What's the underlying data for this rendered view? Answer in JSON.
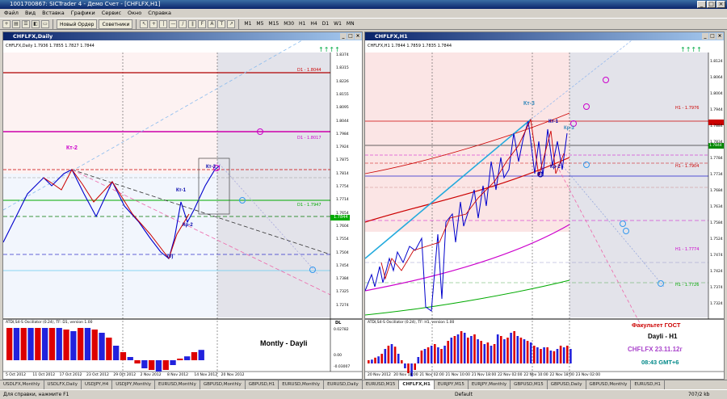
{
  "window": {
    "title": "1001700867: SICTrader 4 - Демо Счет - [CHFLFX,H1]"
  },
  "menu": [
    "Файл",
    "Вид",
    "Вставка",
    "Графики",
    "Сервис",
    "Окно",
    "Справка"
  ],
  "toolbar": {
    "new_order": "Новый Ордер",
    "advisors": "Советники",
    "timeframes": [
      "M1",
      "M5",
      "M15",
      "M30",
      "H1",
      "H4",
      "D1",
      "W1",
      "MN"
    ]
  },
  "left_chart": {
    "title": "CHFLFX,Daily",
    "header": "CHFLFX,Daily 1.7936 1.7855 1.7827 1.7844",
    "labels": {
      "kt2": "Кт-2",
      "kt1": "Кт-1",
      "kr2": "Кр-2",
      "kt3": "Кт-3",
      "zero": "(0)",
      "d1a": "D1 - 1.8044",
      "d1b": "D1 - 1.8017",
      "d1c": "D1 - 1.7947",
      "dl": "DL"
    },
    "price_labels": [
      "1.8374",
      "1.8315",
      "1.8226",
      "1.8155",
      "1.8095",
      "1.8044",
      "1.7984",
      "1.7924",
      "1.7875",
      "1.7814",
      "1.7754",
      "1.7714",
      "1.7654",
      "1.7604",
      "1.7554",
      "1.7504",
      "1.7454",
      "1.7384",
      "1.7325",
      "1.7274"
    ],
    "current_price": "1.7844",
    "indicator_header": "ATDI,S4-S Oscillator (0.24), TF: D1, version 1.00",
    "indicator_scale": [
      "0.02782",
      "0.00",
      "-0.03007"
    ],
    "dates": [
      "5 Oct 2012",
      "11 Oct 2012",
      "17 Oct 2012",
      "23 Oct 2012",
      "29 Oct 2012",
      "2 Nov 2012",
      "8 Nov 2012",
      "14 Nov 2012",
      "20 Nov 2012"
    ],
    "caption": "Montly - Dayli"
  },
  "right_chart": {
    "title": "CHFLFX,H1",
    "header": "CHFLFX,H1 1.7844 1.7859 1.7835 1.7844",
    "labels": {
      "kt3": "Кт-3",
      "kt1": "Кт-1",
      "kr3": "Кр-3",
      "kr2": "Кр-2",
      "zero": "(0)",
      "h1a": "H1 - 1.7976",
      "h1b": "H1 - 1.7904",
      "h1c": "H1 - 1.7774",
      "h1d": "H1 - 1.7726"
    },
    "price_labels": [
      "1.8124",
      "1.8064",
      "1.8004",
      "1.7944",
      "1.7884",
      "1.7834",
      "1.7784",
      "1.7734",
      "1.7684",
      "1.7634",
      "1.7584",
      "1.7524",
      "1.7474",
      "1.7424",
      "1.7374",
      "1.7324"
    ],
    "current_price": "1.7844",
    "indicator_header": "ATDI,S4-S Oscillator (0.24), TF: H1, version 1.00",
    "dates": [
      "20 Nov 2012",
      "20 Nov 18:00",
      "21 Nov 02:00",
      "21 Nov 10:00",
      "21 Nov 18:00",
      "22 Nov 02:00",
      "22 Nov 10:00",
      "22 Nov 18:00",
      "23 Nov 02:00"
    ],
    "info": {
      "line1": "Факультет ГОСТ",
      "line2": "Dayli - H1",
      "line3": "CHFLFX 23.11.12г",
      "line4": "08:43 GMT+6"
    }
  },
  "tabs": [
    "USDLFX,Monthly",
    "USDLFX,Daily",
    "USDJPY,H4",
    "USDJPY,Monthly",
    "EURUSD,Monthly",
    "GBPUSD,Monthly",
    "GBPUSD,H1",
    "EURUSD,Monthly",
    "EURUSD,Daily",
    "EURUSD,M15",
    "CHFLFX,H1",
    "EURJPY,M15",
    "EURJPY,Monthly",
    "GBPUSD,M15",
    "GBPUSD,Daily",
    "GBPUSD,Monthly",
    "EURUSD,H1"
  ],
  "active_tab": "CHFLFX,H1",
  "status": {
    "help": "Для справки, нажмите F1",
    "profile": "Default",
    "traffic": "707/2 kb"
  },
  "colors": {
    "bull": "#0000cc",
    "bear": "#cc0000",
    "accent": "#cc00cc"
  }
}
